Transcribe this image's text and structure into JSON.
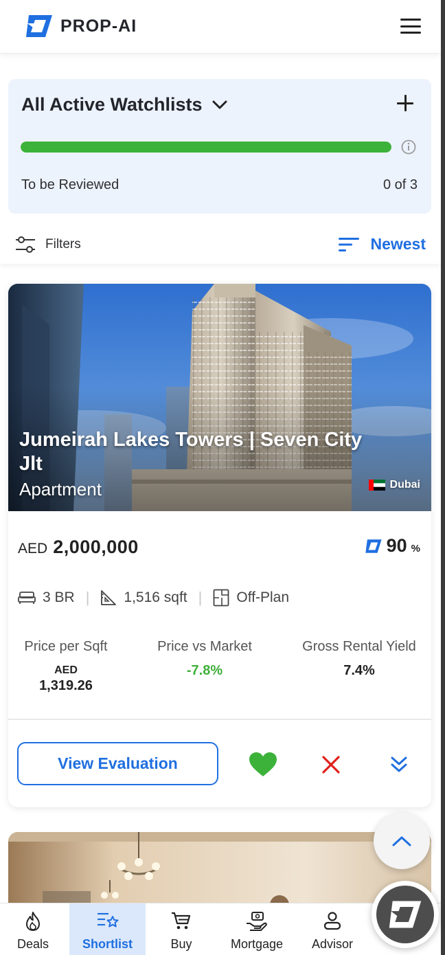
{
  "app": {
    "brand": "PROP-AI"
  },
  "watchlist": {
    "title": "All Active Watchlists",
    "review_label": "To be Reviewed",
    "review_count": "0 of 3",
    "progress_fraction": 1.0
  },
  "toolbar": {
    "filters_label": "Filters",
    "sort_label": "Newest"
  },
  "listing": {
    "title": "Jumeirah Lakes Towers | Seven City Jlt",
    "type": "Apartment",
    "city": "Dubai",
    "currency": "AED",
    "price": "2,000,000",
    "score": "90",
    "score_unit": "%",
    "specs": {
      "bedrooms": "3 BR",
      "area": "1,516 sqft",
      "status": "Off-Plan"
    },
    "metrics": {
      "price_per_sqft_label": "Price per Sqft",
      "price_per_sqft_currency": "AED",
      "price_per_sqft_value": "1,319.26",
      "price_vs_market_label": "Price vs Market",
      "price_vs_market_value": "-7.8%",
      "gross_rental_yield_label": "Gross Rental Yield",
      "gross_rental_yield_value": "7.4%"
    },
    "actions": {
      "view_evaluation_label": "View Evaluation"
    }
  },
  "bottom_nav": [
    {
      "label": "Deals",
      "icon": "flame-icon"
    },
    {
      "label": "Shortlist",
      "icon": "shortlist-star-icon",
      "active": true
    },
    {
      "label": "Buy",
      "icon": "cart-icon"
    },
    {
      "label": "Mortgage",
      "icon": "mortgage-hand-icon"
    },
    {
      "label": "Advisor",
      "icon": "person-icon"
    }
  ],
  "colors": {
    "accent_blue": "#1f6fe0",
    "progress_green": "#3cb23a",
    "positive_green": "#3fb03a",
    "danger_red": "#e0201c",
    "watch_card_bg": "#edf3fd",
    "nav_active_bg": "#dbe8fb"
  }
}
